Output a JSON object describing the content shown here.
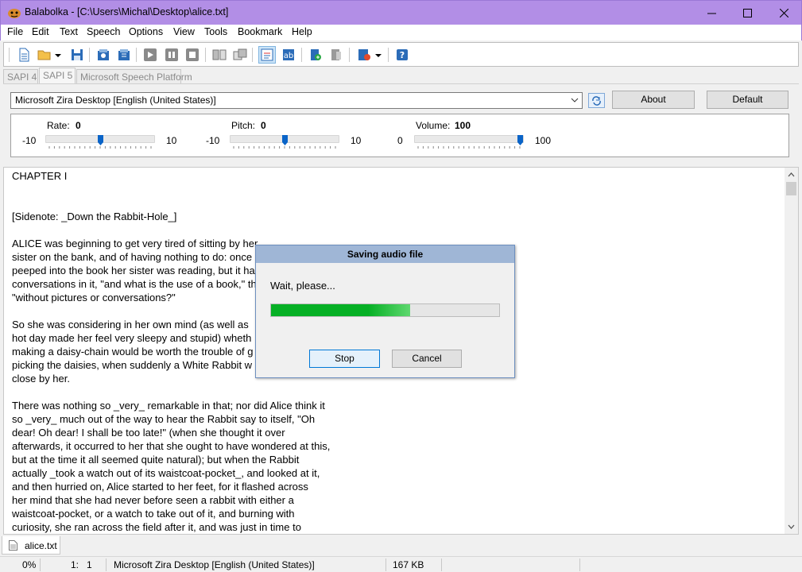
{
  "window": {
    "title": "Balabolka - [C:\\Users\\Michal\\Desktop\\alice.txt]",
    "titlebar_color": "#b28ee6"
  },
  "menu": [
    "File",
    "Edit",
    "Text",
    "Speech",
    "Options",
    "View",
    "Tools",
    "Bookmark",
    "Help"
  ],
  "toolbar_icons": [
    "new-file-icon",
    "open-folder-icon",
    "dropdown-arrow-icon",
    "save-icon",
    "convert-icon",
    "batch-convert-icon",
    "play-icon",
    "pause-icon",
    "stop-icon",
    "split-icon",
    "join-icon",
    "spell-check-icon",
    "read-clipboard-icon",
    "add-icon",
    "remove-icon",
    "record-icon",
    "dropdown-arrow-icon",
    "help-icon"
  ],
  "engine_tabs": [
    "SAPI 4",
    "SAPI 5",
    "Microsoft Speech Platform"
  ],
  "voice": {
    "selected": "Microsoft Zira Desktop [English (United States)]",
    "about_label": "About",
    "default_label": "Default"
  },
  "sliders": {
    "rate": {
      "label": "Rate:",
      "value": "0",
      "min": "-10",
      "max": "10",
      "level": 0.5
    },
    "pitch": {
      "label": "Pitch:",
      "value": "0",
      "min": "-10",
      "max": "10",
      "level": 0.5
    },
    "volume": {
      "label": "Volume:",
      "value": "100",
      "min": "0",
      "max": "100",
      "level": 1.0
    }
  },
  "document": {
    "lines": [
      "CHAPTER I",
      "",
      "",
      "[Sidenote: _Down the Rabbit-Hole_]",
      "",
      "ALICE was beginning to get very tired of sitting by her",
      "sister on the bank, and of having nothing to do: once",
      "peeped into the book her sister was reading, but it ha",
      "conversations in it, \"and what is the use of a book,\" th",
      "\"without pictures or conversations?\"",
      "",
      "So she was considering in her own mind (as well as",
      "hot day made her feel very sleepy and stupid) wheth",
      "making a daisy-chain would be worth the trouble of g",
      "picking the daisies, when suddenly a White Rabbit w",
      "close by her.",
      "",
      "There was nothing so _very_ remarkable in that; nor did Alice think it",
      "so _very_ much out of the way to hear the Rabbit say to itself, \"Oh",
      "dear! Oh dear! I shall be too late!\" (when she thought it over",
      "afterwards, it occurred to her that she ought to have wondered at this,",
      "but at the time it all seemed quite natural); but when the Rabbit",
      "actually _took a watch out of its waistcoat-pocket_, and looked at it,",
      "and then hurried on, Alice started to her feet, for it flashed across",
      "her mind that she had never before seen a rabbit with either a",
      "waistcoat-pocket, or a watch to take out of it, and burning with",
      "curiosity, she ran across the field after it, and was just in time to"
    ]
  },
  "dialog": {
    "title": "Saving audio file",
    "message": "Wait, please...",
    "progress": 0.61,
    "stop_label": "Stop",
    "cancel_label": "Cancel"
  },
  "file_tab": {
    "name": "alice.txt"
  },
  "status": {
    "percent": "0%",
    "position": "1:   1",
    "voice": "Microsoft Zira Desktop [English (United States)]",
    "size": "167 KB"
  }
}
